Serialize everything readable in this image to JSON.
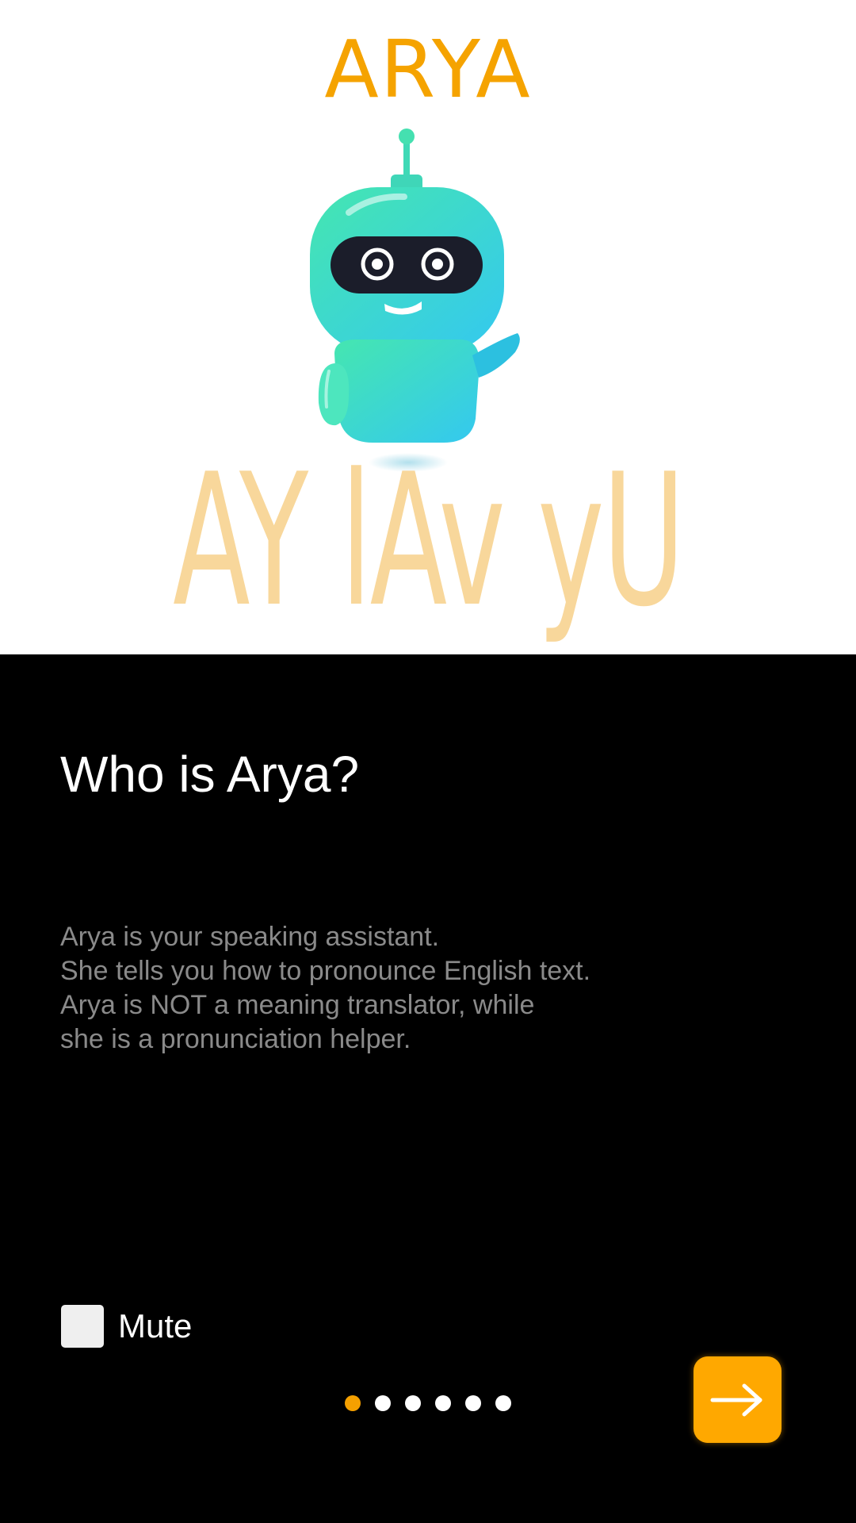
{
  "header": {
    "app_title": "ARYA",
    "phonetic_text": "AY lAv yU"
  },
  "content": {
    "heading": "Who is Arya?",
    "description_lines": [
      "Arya is your speaking assistant.",
      "She tells you how to pronounce English text.",
      "Arya is NOT a meaning translator, while",
      "she is a pronunciation helper."
    ]
  },
  "controls": {
    "mute_label": "Mute",
    "mute_checked": false,
    "page_count": 6,
    "current_page": 1
  },
  "colors": {
    "accent": "#F5A300",
    "phonetic": "#F8D79B",
    "dot_active": "#F5A000",
    "button": "#FFA800"
  },
  "icons": {
    "next": "arrow-right-icon",
    "mascot": "robot-mascot"
  }
}
